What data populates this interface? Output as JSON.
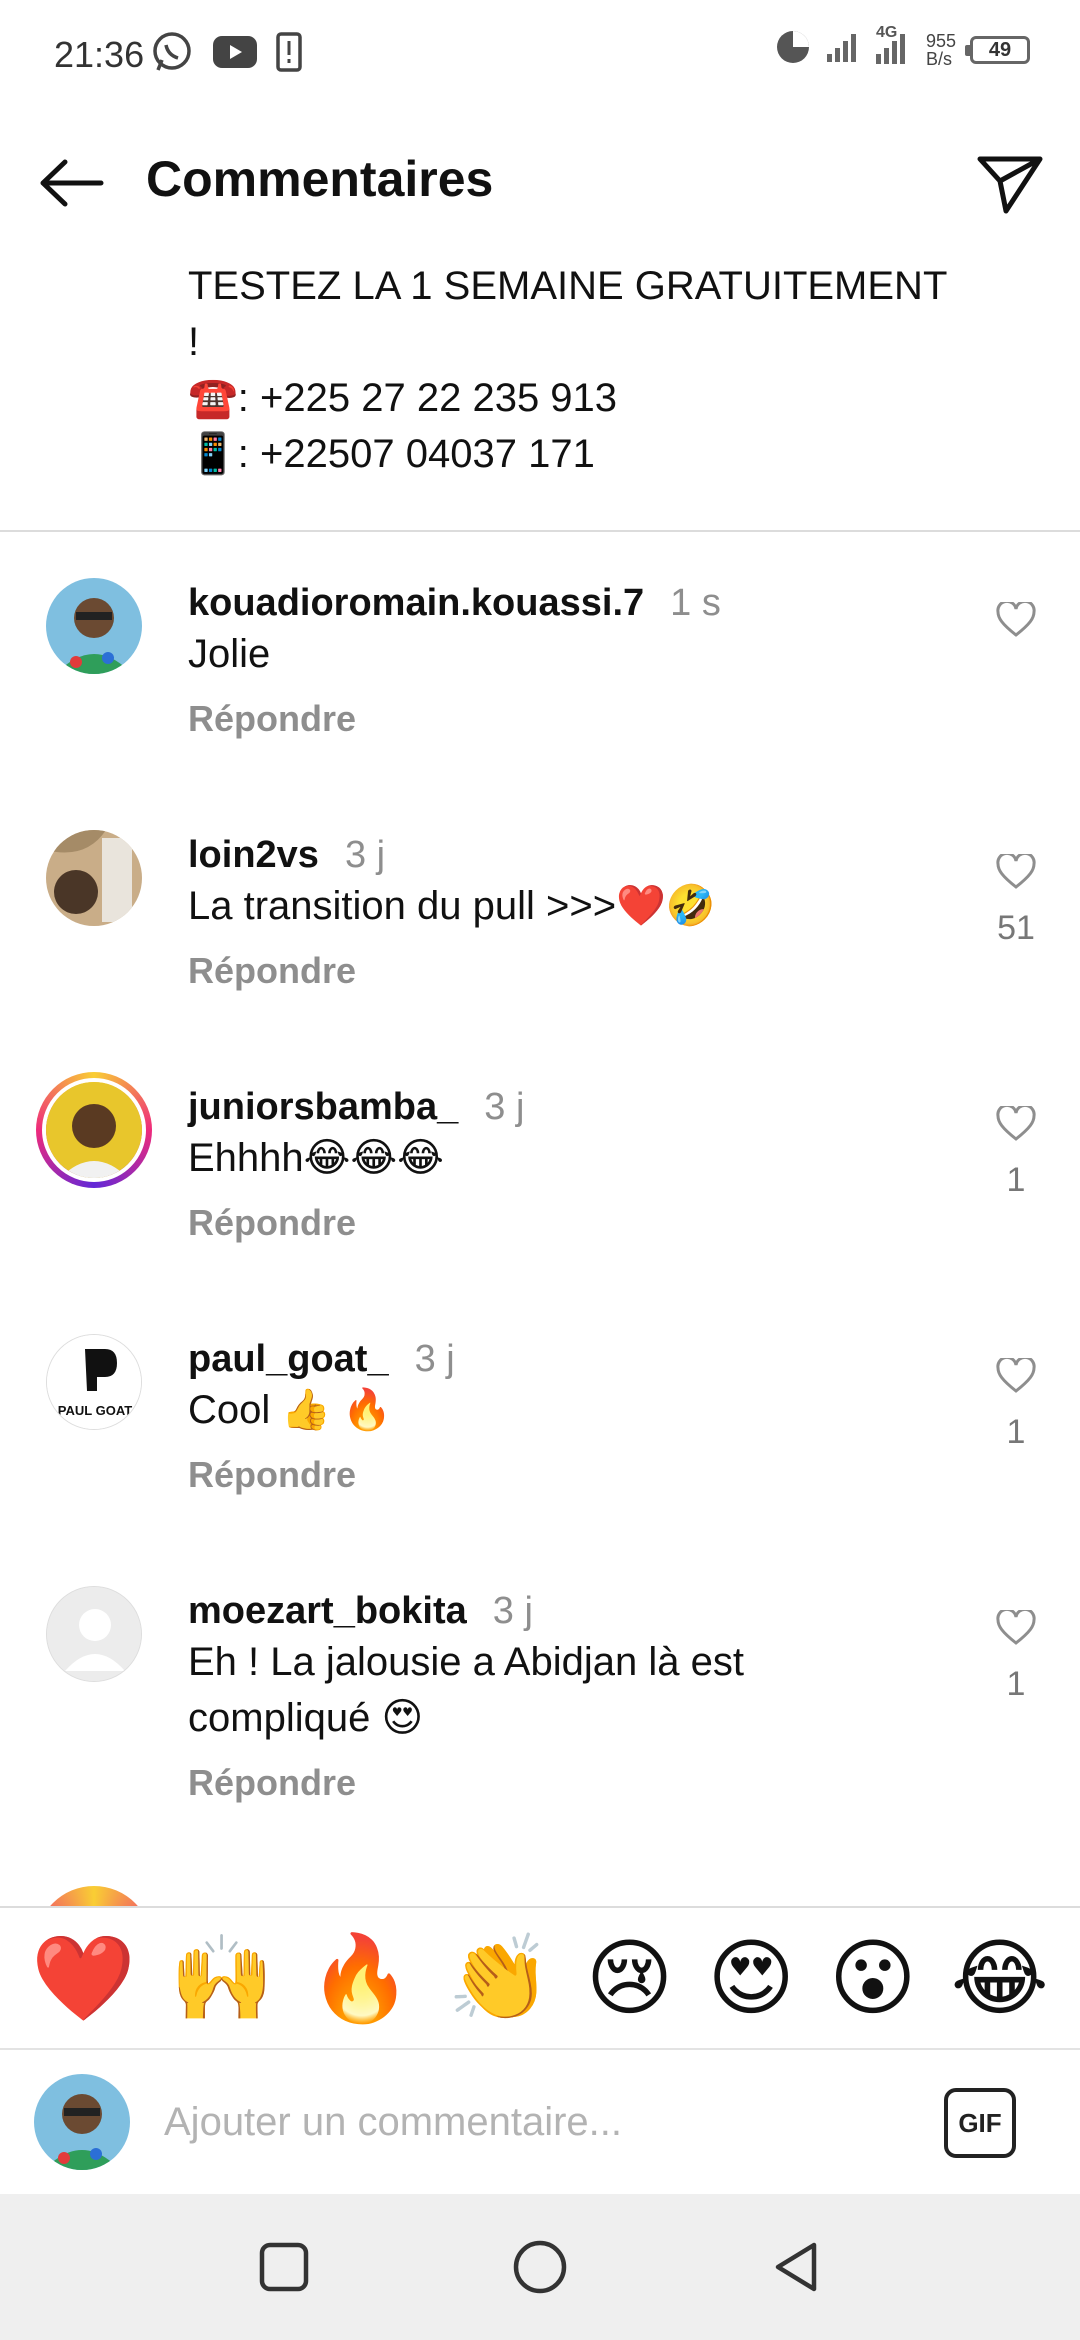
{
  "status_bar": {
    "time": "21:36",
    "network": "4G",
    "speed_value": "955",
    "speed_unit": "B/s",
    "battery": "49"
  },
  "header": {
    "title": "Commentaires"
  },
  "caption": {
    "lines": [
      "TESTEZ LA 1 SEMAINE GRATUITEMENT",
      "!",
      "☎️: +225 27 22 235 913",
      "📱: +22507 04037 171"
    ]
  },
  "comments": [
    {
      "username": "kouadioromain.kouassi.7",
      "time": "1 s",
      "text": "Jolie",
      "reply_label": "Répondre",
      "likes": ""
    },
    {
      "username": "loin2vs",
      "time": "3 j",
      "text": "La transition du pull >>>❤️🤣",
      "reply_label": "Répondre",
      "likes": "51"
    },
    {
      "username": "juniorsbamba_",
      "time": "3 j",
      "text": "Ehhhh😂😂😂",
      "reply_label": "Répondre",
      "likes": "1"
    },
    {
      "username": "paul_goat_",
      "time": "3 j",
      "text": "Cool 👍 🔥",
      "reply_label": "Répondre",
      "likes": "1"
    },
    {
      "username": "moezart_bokita",
      "time": "3 j",
      "text": "Eh ! La jalousie a Abidjan là est compliqué 😍",
      "reply_label": "Répondre",
      "likes": "1"
    }
  ],
  "paul_goat_logo_text": "PAUL GOAT",
  "emoji_bar": [
    "❤️",
    "🙌",
    "🔥",
    "👏",
    "😢",
    "😍",
    "😮",
    "😂"
  ],
  "input": {
    "placeholder": "Ajouter un commentaire...",
    "gif_label": "GIF"
  },
  "colors": {
    "accent_text": "#111111",
    "muted_text": "#8e8e8e",
    "divider": "#dcdcdc",
    "nav_bg": "#efefef"
  }
}
